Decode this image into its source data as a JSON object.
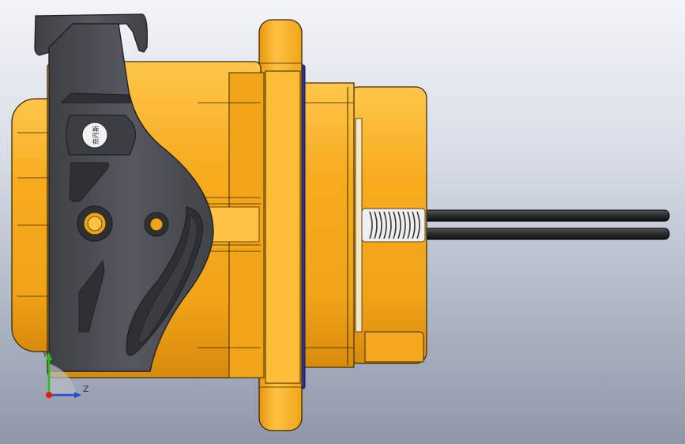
{
  "viewport": {
    "background_top": "#f2f4f8",
    "background_bottom": "#8f98a8"
  },
  "model": {
    "body_color": "#f0a418",
    "body_highlight": "#ffc64a",
    "body_shadow": "#c57a08",
    "latch_color": "#4a4d52",
    "latch_dark": "#2e3034",
    "seal_color": "#2c2f9e",
    "cable_color": "#2b2b2b",
    "spring_color": "#6a6a6a",
    "logo_text": "奈丹斯"
  },
  "triad": {
    "y_label": "Y",
    "z_label": "Z",
    "y_color": "#22c022",
    "z_color": "#2a49d6",
    "x_color": "#e01818"
  }
}
